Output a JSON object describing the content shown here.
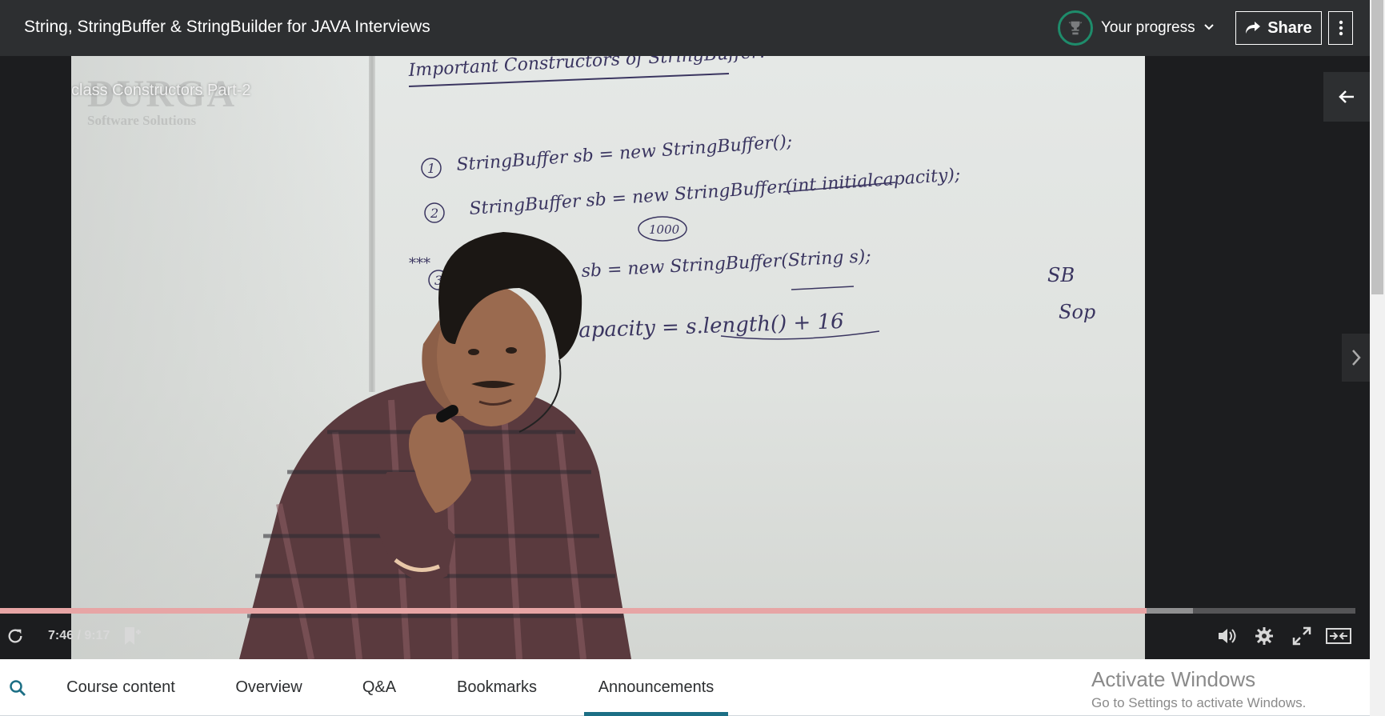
{
  "header": {
    "course_title": "String, StringBuffer & StringBuilder for JAVA Interviews",
    "progress_label": "Your progress",
    "progress_icon": "trophy-icon",
    "share_label": "Share",
    "more_icon": "vertical-dots-icon"
  },
  "video": {
    "watermark_big": "DURGA",
    "watermark_small": "Software Solutions",
    "lecture_label": "class Constructors Part-2",
    "board_lines": {
      "heading": "Important Constructors of StringBuffer:",
      "line1_num": "1",
      "line1": "StringBuffer sb = new StringBuffer();",
      "line2_num": "2",
      "line2": "StringBuffer sb = new StringBuffer(int initialcapacity);",
      "circled": "1000",
      "line3_num": "3",
      "line3_stars": "***",
      "line3": "sb = new StringBuffer(String s);",
      "line4": "capacity = s.length() + 16",
      "side1": "SB",
      "side2": "Sop"
    },
    "progress_fraction": 0.846,
    "buffer_fraction": 0.88,
    "time_current": "7:46",
    "time_total": "9:17",
    "time_readout": "7:46 / 9:17",
    "accent_color": "#e7a5a5"
  },
  "controls": {
    "replay_icon": "replay-icon",
    "bookmark_icon": "add-bookmark-icon",
    "volume_icon": "volume-icon",
    "settings_icon": "gear-icon",
    "fullscreen_icon": "fullscreen-icon",
    "expand_icon": "expand-icon",
    "back_icon": "arrow-left-icon",
    "next_icon": "chevron-right-icon"
  },
  "tabs": {
    "search_icon": "search-icon",
    "items": [
      "Course content",
      "Overview",
      "Q&A",
      "Bookmarks",
      "Announcements"
    ],
    "active": "Announcements",
    "active_color": "#1c6f85"
  },
  "overlay": {
    "activate_title": "Activate Windows",
    "activate_sub": "Go to Settings to activate Windows."
  }
}
